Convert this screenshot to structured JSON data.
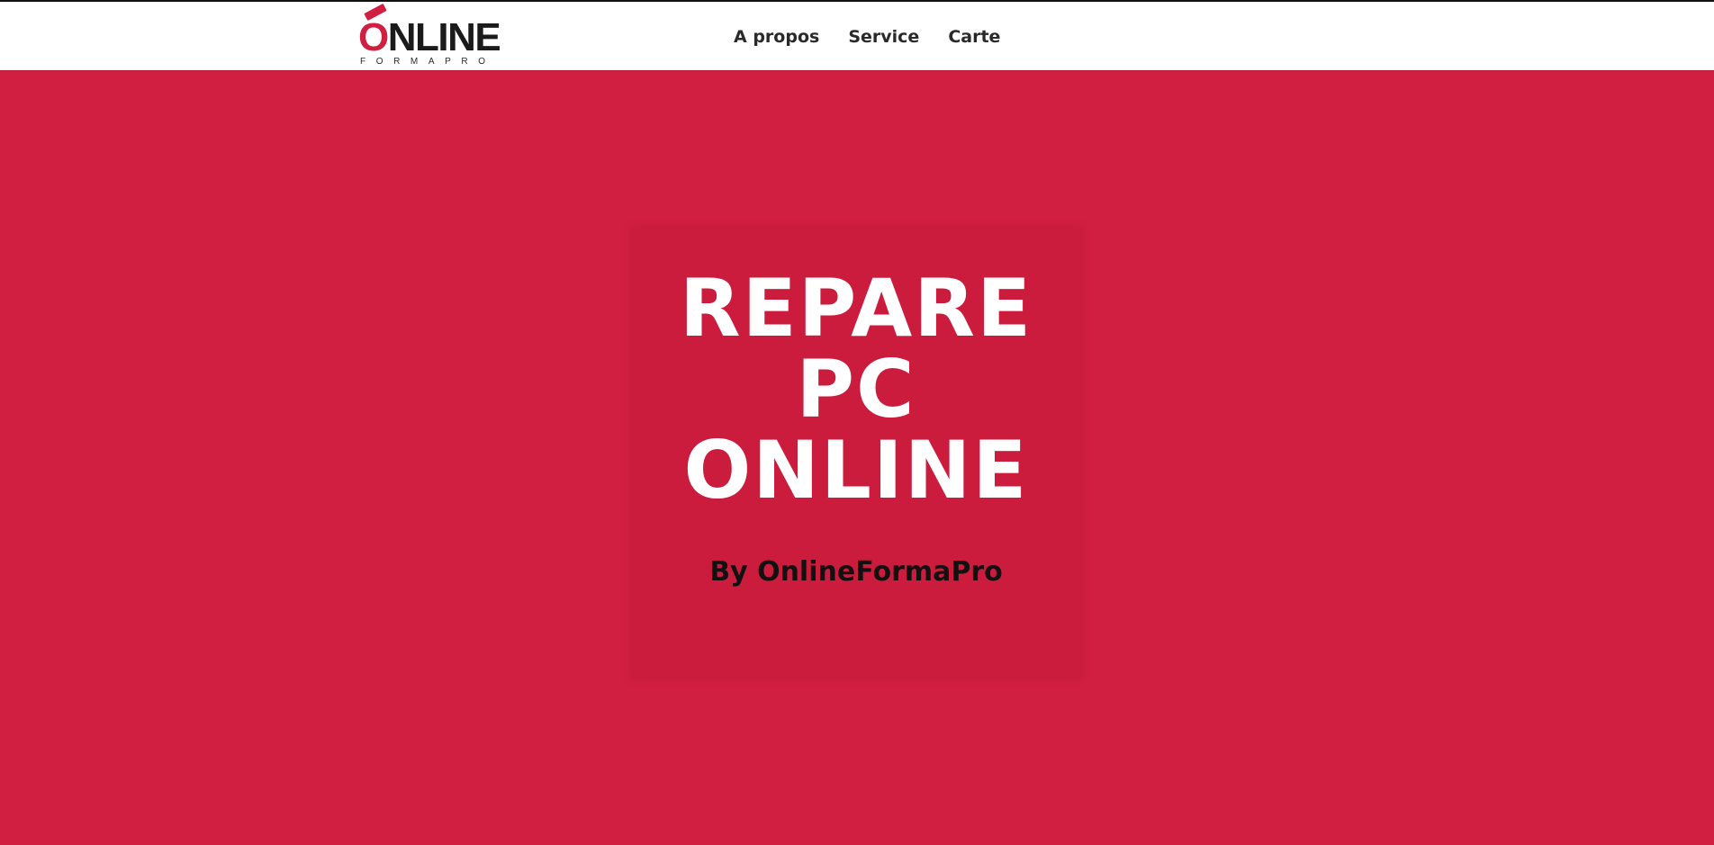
{
  "header": {
    "logo": {
      "wordmark": "ONLINE",
      "tagline": "FORMAPRO"
    },
    "nav": [
      {
        "label": "A propos"
      },
      {
        "label": "Service"
      },
      {
        "label": "Carte"
      }
    ]
  },
  "hero": {
    "title_lines": [
      "REPARE",
      "PC",
      "ONLINE"
    ],
    "subtitle": "By OnlineFormaPro"
  },
  "colors": {
    "brand_red": "#d11f42",
    "header_background": "#ffffff",
    "nav_text": "#2a2a2a",
    "hero_title": "#ffffff",
    "hero_subtitle": "#111111"
  }
}
